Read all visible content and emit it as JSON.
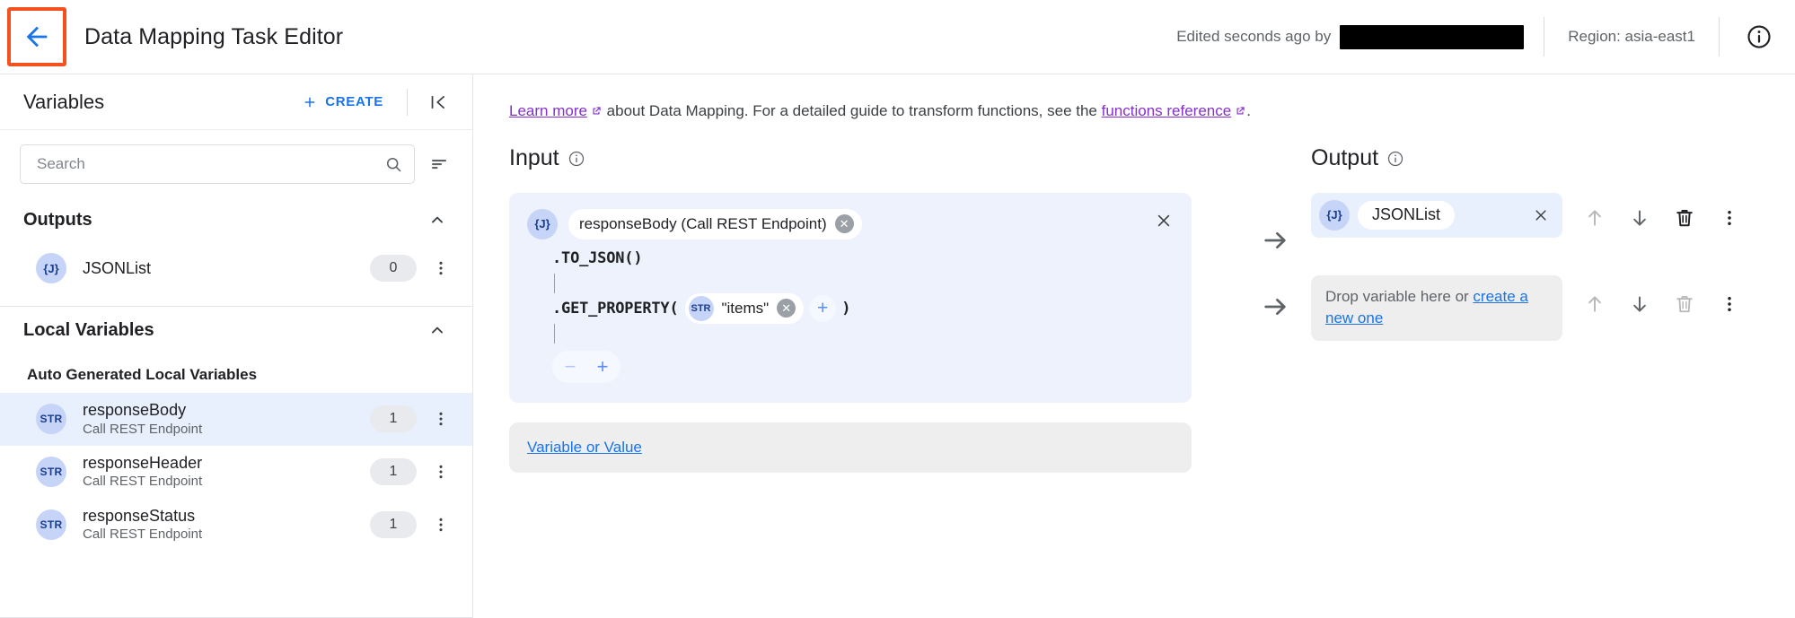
{
  "topbar": {
    "back_icon": "arrow-left-icon",
    "title": "Data Mapping Task Editor",
    "edited_text": "Edited seconds ago by",
    "redacted_user": "",
    "region": "Region: asia-east1",
    "info_icon": "info-icon"
  },
  "sidebar": {
    "title": "Variables",
    "create_label": "CREATE",
    "create_icon": "plus-icon",
    "collapse_icon": "collapse-panel-icon",
    "search": {
      "placeholder": "Search",
      "value": "",
      "icon": "search-icon"
    },
    "sort_icon": "sort-filter-icon",
    "sections": [
      {
        "title": "Outputs",
        "chevron": "chevron-up-icon",
        "items": [
          {
            "badge": "{J}",
            "type": "json",
            "name": "JSONList",
            "sub": "",
            "count": "0"
          }
        ]
      },
      {
        "title": "Local Variables",
        "chevron": "chevron-up-icon",
        "group_label": "Auto Generated Local Variables",
        "items": [
          {
            "badge": "STR",
            "type": "str",
            "name": "responseBody",
            "sub": "Call REST Endpoint",
            "count": "1",
            "selected": true
          },
          {
            "badge": "STR",
            "type": "str",
            "name": "responseHeader",
            "sub": "Call REST Endpoint",
            "count": "1",
            "selected": false
          },
          {
            "badge": "STR",
            "type": "str",
            "name": "responseStatus",
            "sub": "Call REST Endpoint",
            "count": "1",
            "selected": false
          }
        ]
      }
    ]
  },
  "main": {
    "learn_more": "Learn more",
    "learn_mid": " about Data Mapping. For a detailed guide to transform functions, see the ",
    "functions_reference": "functions reference",
    "learn_end": ".",
    "input": {
      "title": "Input",
      "info_icon": "info-icon",
      "row1": {
        "badge": "{J}",
        "variable_chip": "responseBody (Call REST Endpoint)",
        "fn1": ".TO_JSON(",
        "fn1_close": ")",
        "fn2": ".GET_PROPERTY(",
        "fn2_close": ")",
        "arg_badge": "STR",
        "arg_value": "\"items\"",
        "add_arg_icon": "plus-circle-icon",
        "remove_label": "−",
        "add_label": "+",
        "close_icon": "close-icon"
      },
      "row2": {
        "placeholder_link": "Variable or Value"
      }
    },
    "arrow_icon": "arrow-right-icon",
    "output": {
      "title": "Output",
      "info_icon": "info-icon",
      "row1": {
        "badge": "{J}",
        "name": "JSONList",
        "close_icon": "close-icon"
      },
      "row2": {
        "drop_text": "Drop variable here or ",
        "drop_link": "create a new one"
      },
      "actions": {
        "move_up": "arrow-up-icon",
        "move_down": "arrow-down-icon",
        "delete": "trash-icon",
        "more": "more-vert-icon"
      }
    }
  },
  "colors": {
    "accent_blue": "#1a73e8",
    "link_purple": "#8430ce",
    "highlight_orange": "#f4511e",
    "selected_row": "#e8f0fe",
    "input_card": "#eef2fd",
    "empty_card": "#eeeeee"
  }
}
